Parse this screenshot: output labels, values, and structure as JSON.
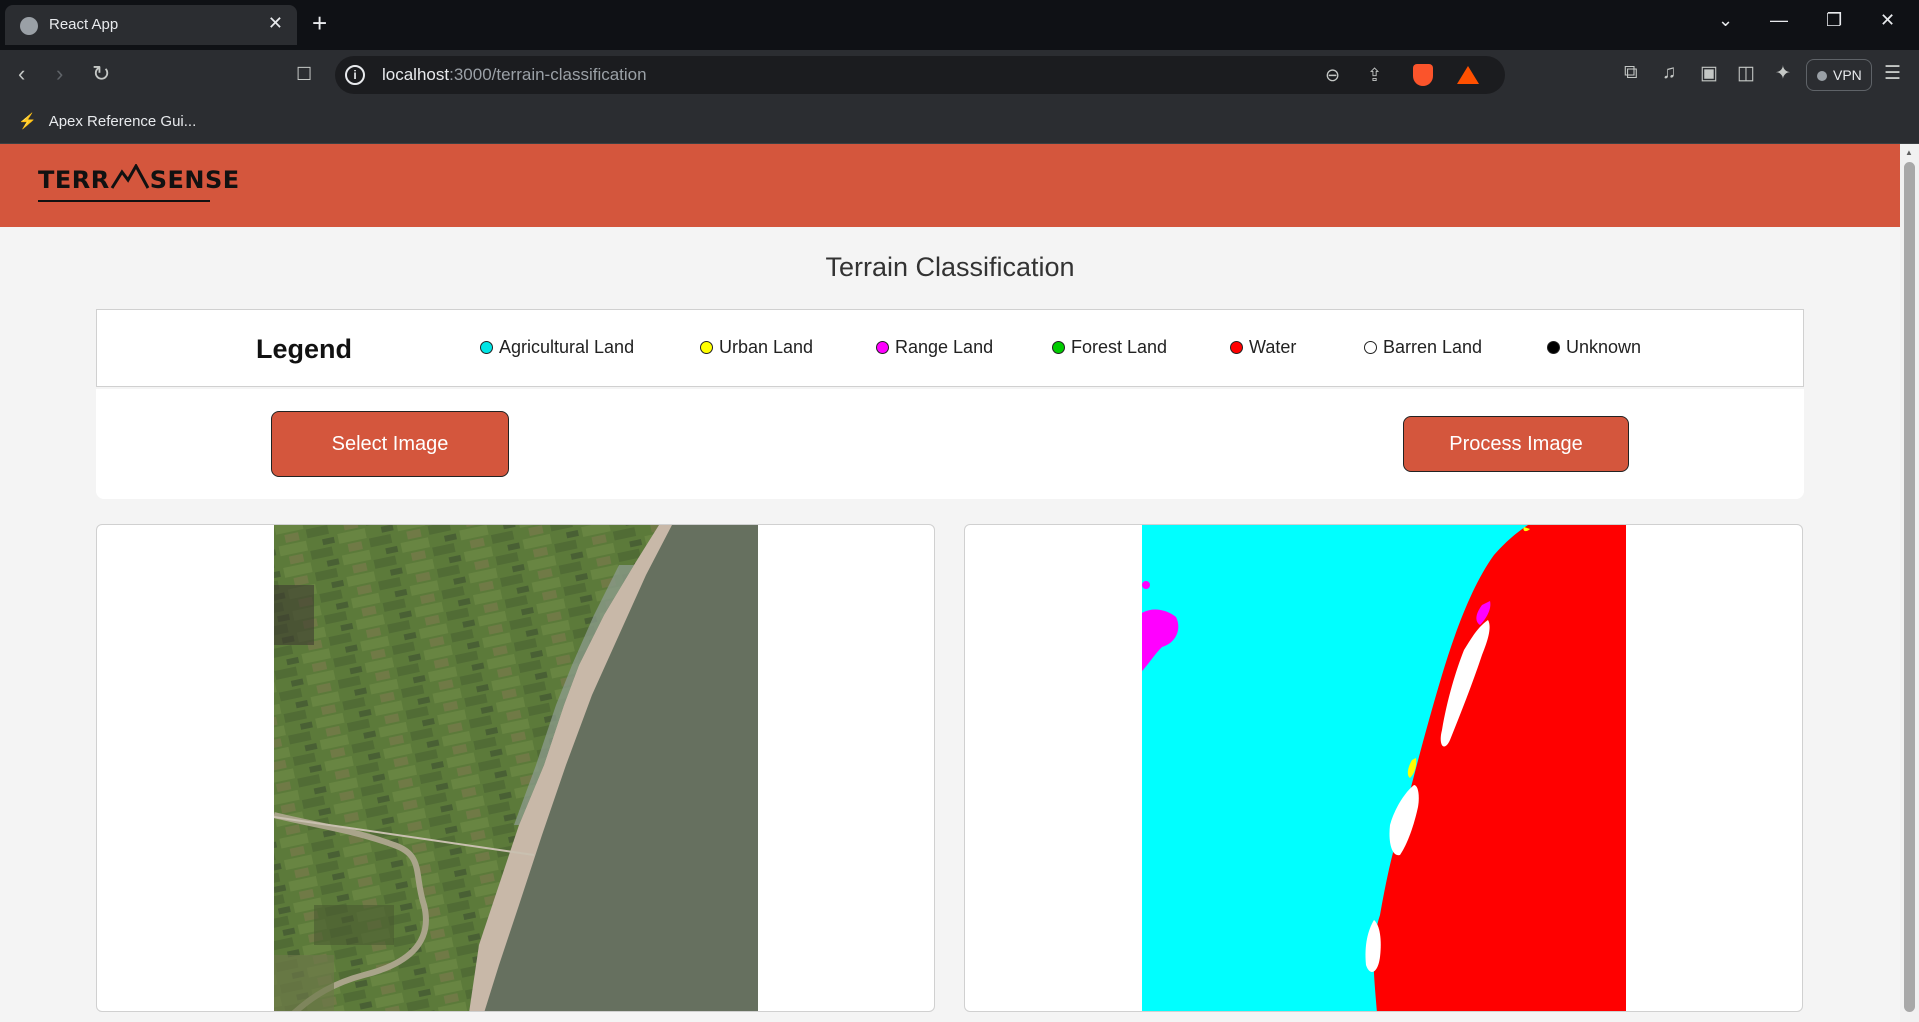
{
  "browser": {
    "tab_title": "React App",
    "tab_close": "✕",
    "new_tab": "+",
    "url_host": "localhost",
    "url_path": ":3000/terrain-classification",
    "bookmark_label": "Apex Reference Gui...",
    "vpn_label": "VPN"
  },
  "header": {
    "logo_left": "TERR",
    "logo_right": "SENSE"
  },
  "page": {
    "title": "Terrain Classification"
  },
  "legend": {
    "title": "Legend",
    "items": [
      {
        "label": "Agricultural Land",
        "color": "#00e5e5"
      },
      {
        "label": "Urban Land",
        "color": "#ffff00"
      },
      {
        "label": "Range Land",
        "color": "#ff00ff"
      },
      {
        "label": "Forest Land",
        "color": "#00cc00"
      },
      {
        "label": "Water",
        "color": "#ff0000"
      },
      {
        "label": "Barren Land",
        "color": "#ffffff"
      },
      {
        "label": "Unknown",
        "color": "#000000"
      }
    ]
  },
  "controls": {
    "select_label": "Select Image",
    "process_label": "Process Image"
  },
  "colors": {
    "brand": "#d4563d",
    "page_bg": "#f4f4f4"
  }
}
